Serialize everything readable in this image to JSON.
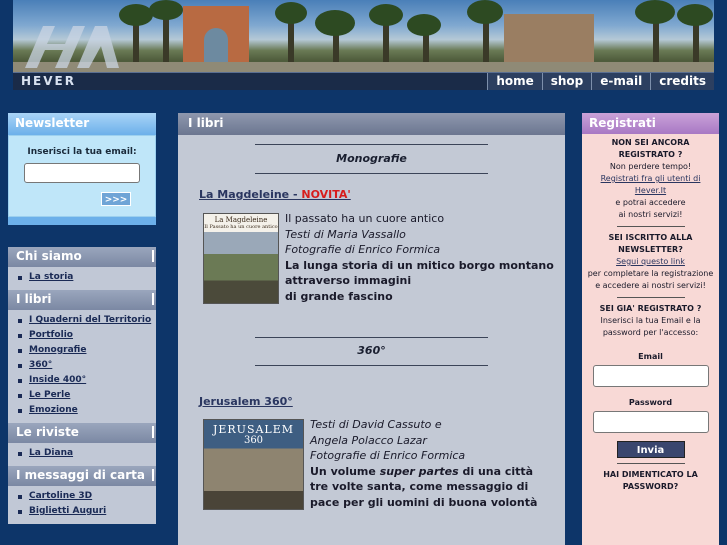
{
  "header": {
    "brand": "HEVER",
    "nav": [
      "home",
      "shop",
      "e-mail",
      "credits"
    ]
  },
  "newsletter": {
    "title": "Newsletter",
    "label": "Inserisci la tua email:",
    "email_value": "",
    "submit": ">>>"
  },
  "menu": [
    {
      "title": "Chi siamo",
      "items": [
        "La storia"
      ]
    },
    {
      "title": "I libri",
      "items": [
        "I Quaderni del Territorio",
        "Portfolio",
        "Monografie",
        "360°",
        "Inside 400°",
        "Le Perle",
        "Emozione"
      ]
    },
    {
      "title": "Le riviste",
      "items": [
        "La Diana"
      ]
    },
    {
      "title": "I messaggi di carta",
      "items": [
        "Cartoline 3D",
        "Biglietti Auguri"
      ]
    }
  ],
  "main": {
    "title": "I libri",
    "sections": [
      {
        "heading": "Monografie",
        "book": {
          "title": "La Magdeleine - ",
          "badge": "NOVITA'",
          "cover_title": "La Magdeleine",
          "cover_subtitle": "Il Passato ha un cuore antico",
          "lines": [
            "Il passato ha un cuore antico",
            "Testi di Maria Vassallo",
            "Fotografie di Enrico Formica",
            "La lunga storia di un mitico borgo montano",
            "attraverso immagini",
            "di grande fascino"
          ]
        }
      },
      {
        "heading": "360°",
        "book": {
          "title": "Jerusalem 360°",
          "cover_title": "JERUSALEM",
          "cover_subtitle": "360",
          "lines": [
            "Testi di David Cassuto e",
            "Angela Polacco Lazar",
            "Fotografie di Enrico Formica"
          ],
          "desc_pre": "Un volume ",
          "desc_em": "super partes",
          "desc_post": " di una città tre volte santa, come messaggio di pace per gli uomini di buona volontà"
        }
      }
    ]
  },
  "register": {
    "title": "Registrati",
    "q1_a": "NON SEI ANCORA",
    "q1_b": "REGISTRATO ?",
    "hint1": "Non perdere tempo!",
    "link1_a": "Registrati fra gli utenti di",
    "link1_b": "Hever.It",
    "hint2_a": "e potrai accedere",
    "hint2_b": "ai nostri servizi!",
    "q2_a": "SEI ISCRITTO ALLA",
    "q2_b": "NEWSLETTER?",
    "link2": "Segui questo link",
    "hint3_a": "per completare la registrazione",
    "hint3_b": "e accedere ai nostri servizi!",
    "q3": "SEI GIA' REGISTRATO ?",
    "hint4_a": "Inserisci la tua Email e la",
    "hint4_b": "password per l'accesso:",
    "email_label": "Email",
    "password_label": "Password",
    "submit": "Invia",
    "q4_a": "HAI DIMENTICATO LA",
    "q4_b": "PASSWORD?"
  }
}
